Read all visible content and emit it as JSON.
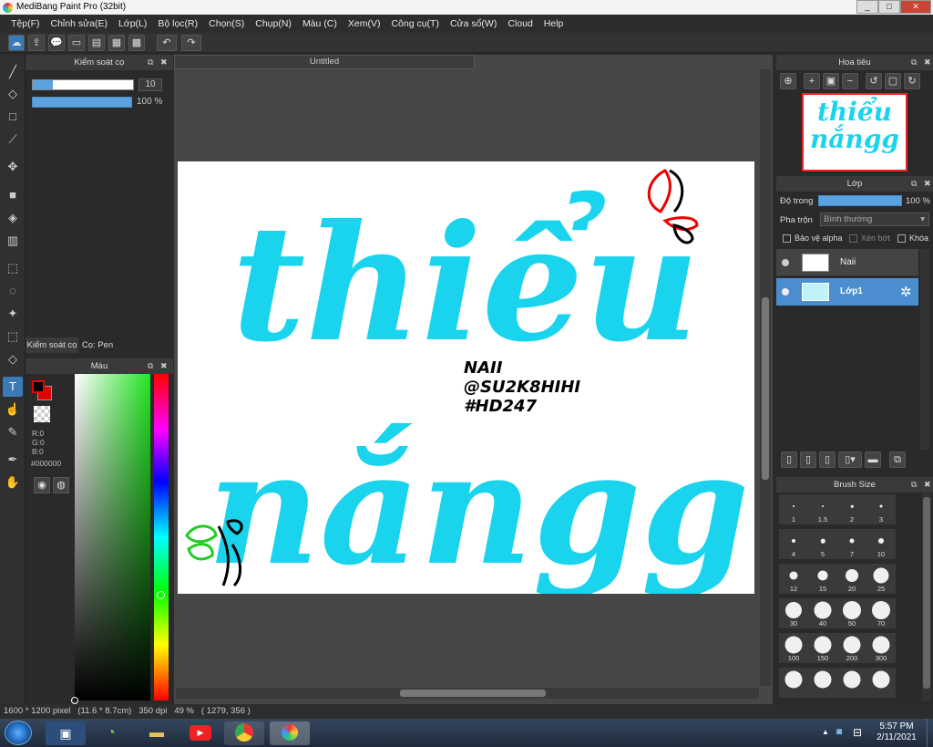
{
  "window": {
    "title": "MediBang Paint Pro (32bit)",
    "minimize": "_",
    "maximize": "□",
    "close": "✕"
  },
  "menu": [
    "Tệp(F)",
    "Chỉnh sửa(E)",
    "Lớp(L)",
    "Bộ lọc(R)",
    "Chọn(S)",
    "Chụp(N)",
    "Màu (C)",
    "Xem(V)",
    "Công cụ(T)",
    "Cửa sổ(W)",
    "Cloud",
    "Help"
  ],
  "brush_control": {
    "title": "Kiểm soát cọ",
    "size_value": "10",
    "opacity_value": "100 %",
    "size_fill_fraction": 0.2,
    "tabs": [
      "Kiểm soát cọ",
      "Cọ: Pen"
    ]
  },
  "color_panel": {
    "title": "Màu",
    "r": "R:0",
    "g": "G:0",
    "b": "B:0",
    "hex": "#000000",
    "fg_color": "#000000",
    "bg_color": "#e00000"
  },
  "document": {
    "tab": "Untitled"
  },
  "artwork": {
    "line1": "thiểu",
    "line2": "nắngg",
    "tag1": "NAII",
    "tag2": "@SU2K8HIHI",
    "tag3": "#HD247",
    "accent": "#1ad4ee"
  },
  "navigator": {
    "title": "Hoa tiêu"
  },
  "layers": {
    "title": "Lớp",
    "opacity_label": "Độ trong",
    "opacity_value": "100 %",
    "blend_label": "Pha trộn",
    "blend_value": "Bình thường",
    "protect_alpha": "Bảo vệ alpha",
    "clip": "Xén bớt",
    "lock": "Khóa",
    "items": [
      {
        "name": "Naii",
        "selected": false
      },
      {
        "name": "Lớp1",
        "selected": true
      }
    ]
  },
  "brush_size": {
    "title": "Brush Size",
    "sizes": [
      "1",
      "1.5",
      "2",
      "3",
      "4",
      "5",
      "7",
      "10",
      "12",
      "15",
      "20",
      "25",
      "30",
      "40",
      "50",
      "70",
      "100",
      "150",
      "200",
      "300",
      "",
      "",
      "",
      ""
    ]
  },
  "status": {
    "dims": "1600 * 1200 pixel",
    "cm": "(11.6 * 8.7cm)",
    "dpi": "350 dpi",
    "zoom": "49 %",
    "coords": "( 1279, 356 )"
  },
  "taskbar": {
    "time": "5:57 PM",
    "date": "2/11/2021"
  }
}
